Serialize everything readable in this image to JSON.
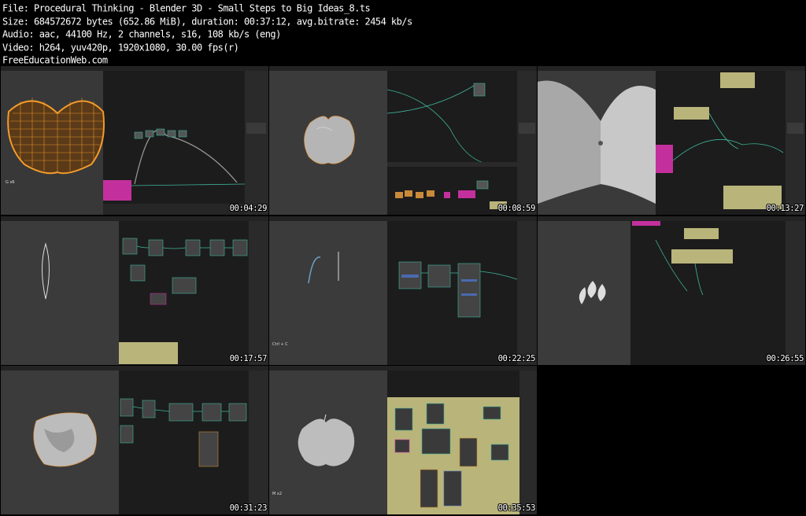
{
  "header": {
    "file_line": "File: Procedural Thinking - Blender 3D - Small Steps to Big Ideas_8.ts",
    "size_line": "Size: 684572672 bytes (652.86 MiB), duration: 00:37:12, avg.bitrate: 2454 kb/s",
    "audio_line": "Audio: aac, 44100 Hz, 2 channels, s16, 108 kb/s (eng)",
    "video_line": "Video: h264, yuv420p, 1920x1080, 30.00 fps(r)",
    "site_line": "FreeEducationWeb.com"
  },
  "thumbnails": [
    {
      "timestamp": "00:04:29",
      "subject": "orange-wireframe-apple",
      "shortcut": "G x6"
    },
    {
      "timestamp": "00:08:59",
      "subject": "apple-mesh"
    },
    {
      "timestamp": "00:13:27",
      "subject": "large-gray-surface"
    },
    {
      "timestamp": "00:17:57",
      "subject": "thin-leaf-curve"
    },
    {
      "timestamp": "00:22:25",
      "subject": "curve-lines",
      "shortcut": "Ctrl + C"
    },
    {
      "timestamp": "00:26:55",
      "subject": "small-leaf-shapes"
    },
    {
      "timestamp": "00:31:23",
      "subject": "sculpted-mesh"
    },
    {
      "timestamp": "00:35:53",
      "subject": "apple-mesh-smooth",
      "shortcut": "M x2"
    }
  ],
  "colors": {
    "background": "#000000",
    "viewport": "#3a3a3a",
    "node_editor": "#1d1d1d",
    "wire": "#3fb59a",
    "wireframe": "#f39a2b",
    "frame_yellow": "#b9b47a",
    "magenta": "#c3309d"
  }
}
